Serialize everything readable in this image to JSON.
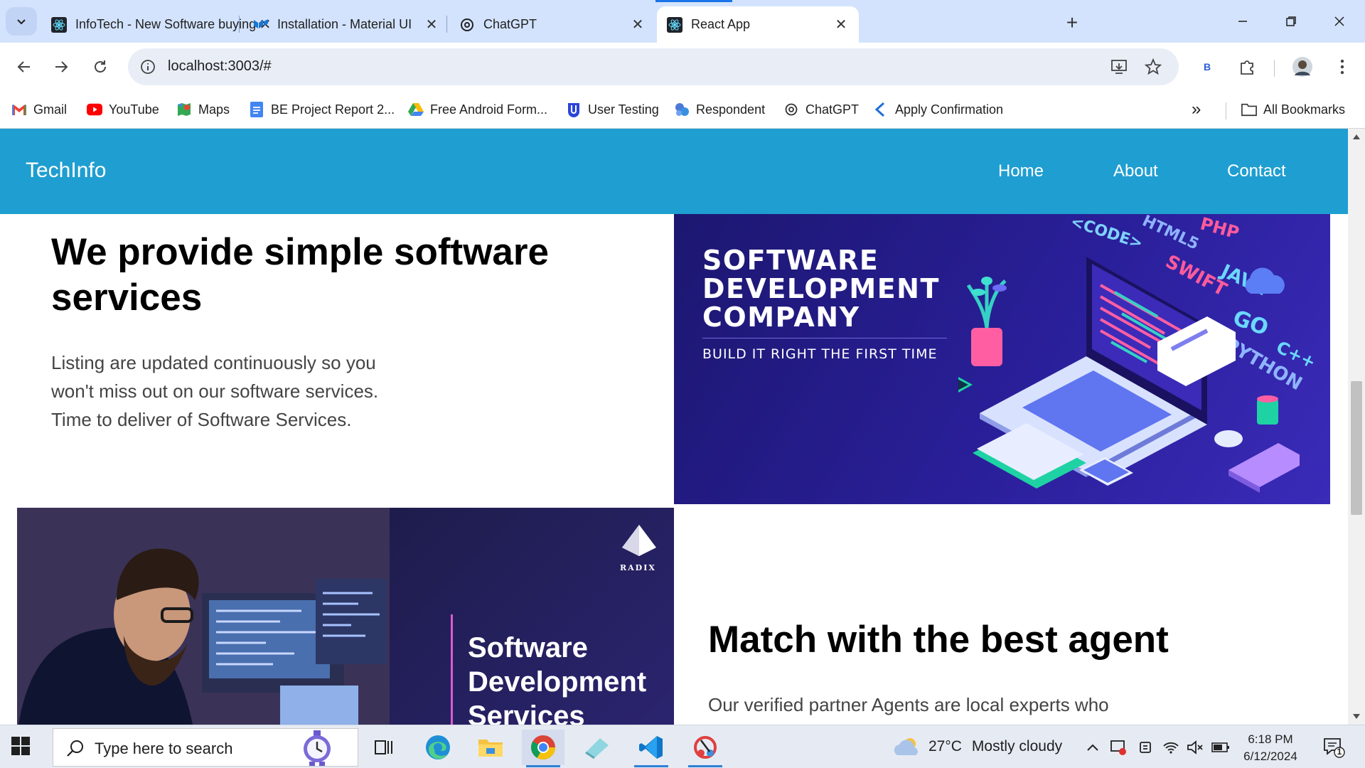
{
  "browser": {
    "tabs": [
      {
        "title": "InfoTech - New Software buying",
        "icon": "react-icon"
      },
      {
        "title": "Installation - Material UI",
        "icon": "mui-icon"
      },
      {
        "title": "ChatGPT",
        "icon": "chatgpt-icon"
      },
      {
        "title": "React App",
        "icon": "react-icon",
        "active": true
      }
    ],
    "url": "localhost:3003/#",
    "profile_badge": "B",
    "bookmarks": [
      {
        "label": "Gmail",
        "icon": "gmail-icon"
      },
      {
        "label": "YouTube",
        "icon": "youtube-icon"
      },
      {
        "label": "Maps",
        "icon": "maps-icon"
      },
      {
        "label": "BE Project Report 2...",
        "icon": "docs-icon"
      },
      {
        "label": "Free Android Form...",
        "icon": "drive-icon"
      },
      {
        "label": "User Testing",
        "icon": "usertesting-icon"
      },
      {
        "label": "Respondent",
        "icon": "respondent-icon"
      },
      {
        "label": "ChatGPT",
        "icon": "chatgpt-icon"
      },
      {
        "label": "Apply Confirmation",
        "icon": "apply-icon"
      }
    ],
    "all_bookmarks": "All Bookmarks",
    "accent": "#1a73e8"
  },
  "site": {
    "brand": "TechInfo",
    "nav": [
      "Home",
      "About",
      "Contact"
    ],
    "nav_color": "#1f9ed1",
    "hero": {
      "title": "We provide simple software services",
      "body": "Listing are updated continuously so you won't miss out on our software services. Time to deliver of Software Services."
    },
    "banner1": {
      "headline_lines": [
        "SOFTWARE",
        "DEVELOPMENT",
        "COMPANY"
      ],
      "subline": "BUILD IT RIGHT THE FIRST TIME",
      "keywords": [
        "<CODE>",
        "HTML5",
        "PHP",
        "SWIFT",
        "JAVA",
        "GO",
        "PYTHON",
        "C++"
      ]
    },
    "banner2": {
      "title_lines": [
        "Software",
        "Development",
        "Services"
      ],
      "logo_text": "RADIX"
    },
    "match": {
      "title": "Match with the best agent",
      "body": "Our verified partner Agents are local experts who"
    }
  },
  "taskbar": {
    "search_placeholder": "Type here to search",
    "weather_temp": "27°C",
    "weather_desc": "Mostly cloudy",
    "time": "6:18 PM",
    "date": "6/12/2024",
    "notification_count": "1"
  }
}
